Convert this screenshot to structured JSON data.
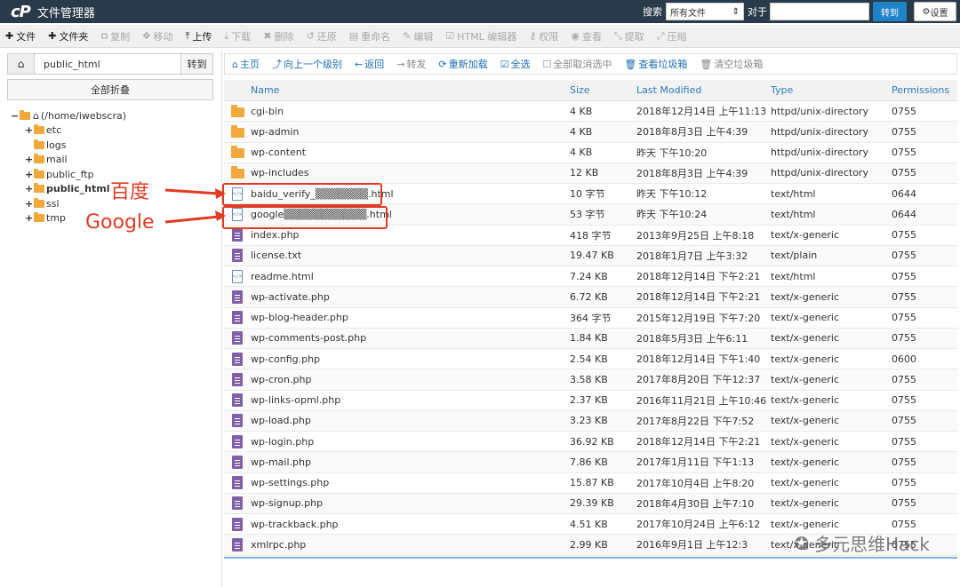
{
  "header": {
    "logo": "cP",
    "title": "文件管理器",
    "search_label": "搜索",
    "search_scope": "所有文件",
    "search_for": "对于",
    "search_placeholder": "",
    "go": "转到",
    "settings": "设置"
  },
  "toolbar": [
    {
      "icon": "plus-icon",
      "glyph": "✚",
      "label": "文件",
      "enabled": true
    },
    {
      "icon": "plus-icon",
      "glyph": "✚",
      "label": "文件夹",
      "enabled": true
    },
    {
      "icon": "copy-icon",
      "glyph": "⧉",
      "label": "复制",
      "enabled": false
    },
    {
      "icon": "move-icon",
      "glyph": "✥",
      "label": "移动",
      "enabled": false
    },
    {
      "icon": "upload-icon",
      "glyph": "⤒",
      "label": "上传",
      "enabled": true
    },
    {
      "icon": "download-icon",
      "glyph": "⤓",
      "label": "下载",
      "enabled": false
    },
    {
      "icon": "delete-icon",
      "glyph": "✖",
      "label": "删除",
      "enabled": false
    },
    {
      "icon": "restore-icon",
      "glyph": "↺",
      "label": "还原",
      "enabled": false
    },
    {
      "icon": "rename-icon",
      "glyph": "▤",
      "label": "重命名",
      "enabled": false
    },
    {
      "icon": "edit-icon",
      "glyph": "✎",
      "label": "编辑",
      "enabled": false
    },
    {
      "icon": "html-editor-icon",
      "glyph": "☑",
      "label": "HTML 编辑器",
      "enabled": false
    },
    {
      "icon": "key-icon",
      "glyph": "⚷",
      "label": "权限",
      "enabled": false
    },
    {
      "icon": "view-icon",
      "glyph": "◉",
      "label": "查看",
      "enabled": false
    },
    {
      "icon": "extract-icon",
      "glyph": "⤡",
      "label": "提取",
      "enabled": false
    },
    {
      "icon": "compress-icon",
      "glyph": "⤢",
      "label": "压缩",
      "enabled": false
    }
  ],
  "left": {
    "path_value": "public_html",
    "go": "转到",
    "collapse_all": "全部折叠",
    "tree": [
      {
        "label": "(/home/iwebscra)",
        "level": 0,
        "expander": "−",
        "home": true,
        "bold": false
      },
      {
        "label": "etc",
        "level": 1,
        "expander": "+",
        "bold": false
      },
      {
        "label": "logs",
        "level": 1,
        "expander": "",
        "bold": false
      },
      {
        "label": "mail",
        "level": 1,
        "expander": "+",
        "bold": false
      },
      {
        "label": "public_ftp",
        "level": 1,
        "expander": "+",
        "bold": false
      },
      {
        "label": "public_html",
        "level": 1,
        "expander": "+",
        "bold": true
      },
      {
        "label": "ssl",
        "level": 1,
        "expander": "+",
        "bold": false
      },
      {
        "label": "tmp",
        "level": 1,
        "expander": "+",
        "bold": false
      }
    ]
  },
  "actions": [
    {
      "icon": "home-icon",
      "glyph": "⌂",
      "label": "主页",
      "gray": false
    },
    {
      "icon": "level-up-icon",
      "glyph": "⤴",
      "label": "向上一个级别",
      "gray": false
    },
    {
      "icon": "back-icon",
      "glyph": "←",
      "label": "返回",
      "gray": false
    },
    {
      "icon": "forward-icon",
      "glyph": "→",
      "label": "转发",
      "gray": true
    },
    {
      "icon": "reload-icon",
      "glyph": "⟳",
      "label": "重新加载",
      "gray": false
    },
    {
      "icon": "check-icon",
      "glyph": "☑",
      "label": "全选",
      "gray": false
    },
    {
      "icon": "uncheck-icon",
      "glyph": "☐",
      "label": "全部取消选中",
      "gray": true
    },
    {
      "icon": "trash-icon",
      "glyph": "🗑",
      "label": "查看垃圾箱",
      "gray": false
    },
    {
      "icon": "trash-icon",
      "glyph": "🗑",
      "label": "清空垃圾箱",
      "gray": true
    }
  ],
  "table": {
    "columns": {
      "name": "Name",
      "size": "Size",
      "modified": "Last Modified",
      "type": "Type",
      "perms": "Permissions"
    },
    "rows": [
      {
        "kind": "folder",
        "name": "cgi-bin",
        "size": "4 KB",
        "modified": "2018年12月14日 上午11:13",
        "type": "httpd/unix-directory",
        "perms": "0755"
      },
      {
        "kind": "folder",
        "name": "wp-admin",
        "size": "4 KB",
        "modified": "2018年8月3日 上午4:39",
        "type": "httpd/unix-directory",
        "perms": "0755"
      },
      {
        "kind": "folder",
        "name": "wp-content",
        "size": "4 KB",
        "modified": "昨天 下午10:20",
        "type": "httpd/unix-directory",
        "perms": "0755"
      },
      {
        "kind": "folder",
        "name": "wp-includes",
        "size": "12 KB",
        "modified": "2018年8月3日 上午4:39",
        "type": "httpd/unix-directory",
        "perms": "0755"
      },
      {
        "kind": "html",
        "name": "baidu_verify_▒▒▒▒▒▒▒.html",
        "size": "10 字节",
        "modified": "昨天 下午10:12",
        "type": "text/html",
        "perms": "0644"
      },
      {
        "kind": "html",
        "name": "google▒▒▒▒▒▒▒▒▒▒▒.html",
        "size": "53 字节",
        "modified": "昨天 下午10:24",
        "type": "text/html",
        "perms": "0644"
      },
      {
        "kind": "file",
        "name": "index.php",
        "size": "418 字节",
        "modified": "2013年9月25日 上午8:18",
        "type": "text/x-generic",
        "perms": "0755"
      },
      {
        "kind": "file",
        "name": "license.txt",
        "size": "19.47 KB",
        "modified": "2018年1月7日 上午3:32",
        "type": "text/plain",
        "perms": "0755"
      },
      {
        "kind": "html",
        "name": "readme.html",
        "size": "7.24 KB",
        "modified": "2018年12月14日 下午2:21",
        "type": "text/html",
        "perms": "0755"
      },
      {
        "kind": "file",
        "name": "wp-activate.php",
        "size": "6.72 KB",
        "modified": "2018年12月14日 下午2:21",
        "type": "text/x-generic",
        "perms": "0755"
      },
      {
        "kind": "file",
        "name": "wp-blog-header.php",
        "size": "364 字节",
        "modified": "2015年12月19日 下午7:20",
        "type": "text/x-generic",
        "perms": "0755"
      },
      {
        "kind": "file",
        "name": "wp-comments-post.php",
        "size": "1.84 KB",
        "modified": "2018年5月3日 上午6:11",
        "type": "text/x-generic",
        "perms": "0755"
      },
      {
        "kind": "file",
        "name": "wp-config.php",
        "size": "2.54 KB",
        "modified": "2018年12月14日 下午1:40",
        "type": "text/x-generic",
        "perms": "0600"
      },
      {
        "kind": "file",
        "name": "wp-cron.php",
        "size": "3.58 KB",
        "modified": "2017年8月20日 下午12:37",
        "type": "text/x-generic",
        "perms": "0755"
      },
      {
        "kind": "file",
        "name": "wp-links-opml.php",
        "size": "2.37 KB",
        "modified": "2016年11月21日 上午10:46",
        "type": "text/x-generic",
        "perms": "0755"
      },
      {
        "kind": "file",
        "name": "wp-load.php",
        "size": "3.23 KB",
        "modified": "2017年8月22日 下午7:52",
        "type": "text/x-generic",
        "perms": "0755"
      },
      {
        "kind": "file",
        "name": "wp-login.php",
        "size": "36.92 KB",
        "modified": "2018年12月14日 下午2:21",
        "type": "text/x-generic",
        "perms": "0755"
      },
      {
        "kind": "file",
        "name": "wp-mail.php",
        "size": "7.86 KB",
        "modified": "2017年1月11日 下午1:13",
        "type": "text/x-generic",
        "perms": "0755"
      },
      {
        "kind": "file",
        "name": "wp-settings.php",
        "size": "15.87 KB",
        "modified": "2017年10月4日 上午8:20",
        "type": "text/x-generic",
        "perms": "0755"
      },
      {
        "kind": "file",
        "name": "wp-signup.php",
        "size": "29.39 KB",
        "modified": "2018年4月30日 上午7:10",
        "type": "text/x-generic",
        "perms": "0755"
      },
      {
        "kind": "file",
        "name": "wp-trackback.php",
        "size": "4.51 KB",
        "modified": "2017年10月24日 上午6:12",
        "type": "text/x-generic",
        "perms": "0755"
      },
      {
        "kind": "file",
        "name": "xmlrpc.php",
        "size": "2.99 KB",
        "modified": "2016年9月1日 上午12:3",
        "type": "text/x-generic",
        "perms": "0755"
      }
    ]
  },
  "annotations": {
    "baidu": "百度",
    "google": "Google",
    "color": "#e23a23"
  },
  "watermark": "多元思维Hack"
}
